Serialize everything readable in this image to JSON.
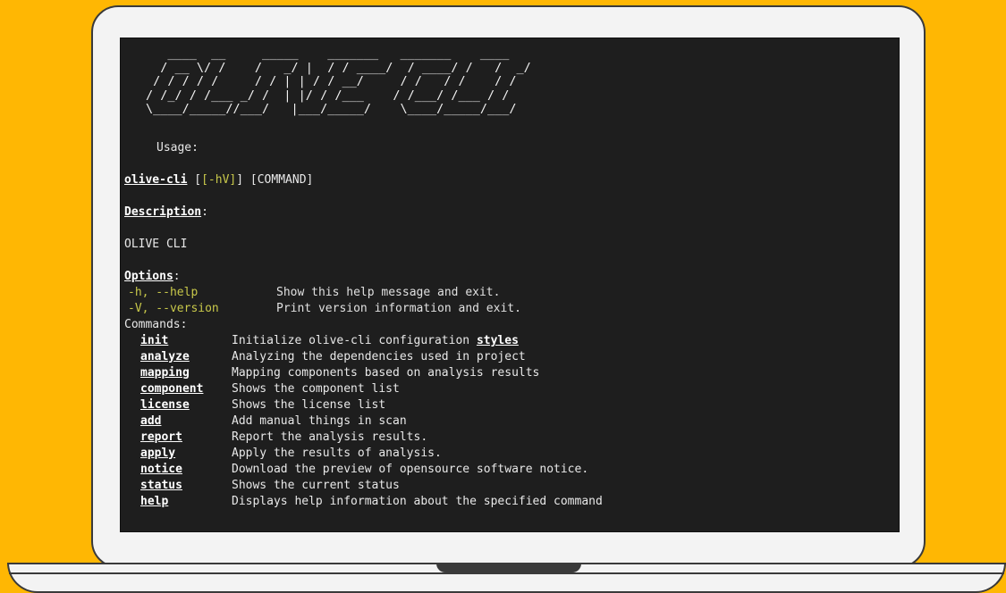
{
  "banner_ascii": "   ____  __     _____    _______   _______    ____\n  / __ \\/ /    /   _/ |  / / ____/  / ____/ /   /  _/\n / / / / /     / / | | / / __/     / /   / /    / /\n/ /_/ / /___ _/ /  | |/ / /___    / /___/ /___ / /\n\\____/_____//___/   |___/_____/    \\____/_____/___/",
  "usage_label": "Usage:",
  "usage": {
    "program": "olive-cli",
    "flags": "[-hV]",
    "command": "[COMMAND]"
  },
  "description_label": "Description",
  "description_text": "OLIVE CLI",
  "options_label": "Options",
  "options": [
    {
      "flag": "-h, --help",
      "desc": "Show this help message and exit."
    },
    {
      "flag": "-V, --version",
      "desc": "Print version information and exit."
    }
  ],
  "commands_label": "Commands:",
  "commands": [
    {
      "name": "init",
      "desc": "Initialize olive-cli configuration ",
      "extra": "styles"
    },
    {
      "name": "analyze",
      "desc": "Analyzing the dependencies used in project",
      "extra": ""
    },
    {
      "name": "mapping",
      "desc": "Mapping components based on analysis results",
      "extra": ""
    },
    {
      "name": "component",
      "desc": "Shows the component list",
      "extra": ""
    },
    {
      "name": "license",
      "desc": "Shows the license list",
      "extra": ""
    },
    {
      "name": "add",
      "desc": "Add manual things in scan",
      "extra": ""
    },
    {
      "name": "report",
      "desc": "Report the analysis results.",
      "extra": ""
    },
    {
      "name": "apply",
      "desc": "Apply the results of analysis.",
      "extra": ""
    },
    {
      "name": "notice",
      "desc": "Download the preview of opensource software notice.",
      "extra": ""
    },
    {
      "name": "status",
      "desc": "Shows the current status",
      "extra": ""
    },
    {
      "name": "help",
      "desc": "Displays help information about the specified command",
      "extra": ""
    }
  ],
  "colors": {
    "background": "#FFB703",
    "terminal": "#1e1e1e",
    "option_accent": "#c8c84a"
  }
}
